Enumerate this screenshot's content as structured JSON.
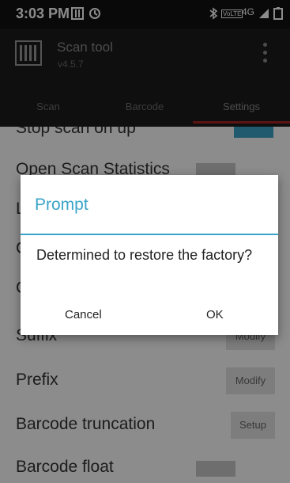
{
  "status_bar": {
    "time": "3:03 PM",
    "network_label": "4G",
    "volte_label": "VoLTE",
    "icons": [
      "gallery-icon",
      "sync-icon",
      "bluetooth-icon",
      "signal-icon",
      "battery-icon"
    ]
  },
  "app_bar": {
    "title": "Scan tool",
    "version": "v4.5.7",
    "menu_icon": "more-vert-icon"
  },
  "tabs": [
    {
      "label": "Scan",
      "active": false
    },
    {
      "label": "Barcode",
      "active": false
    },
    {
      "label": "Settings",
      "active": true
    }
  ],
  "settings": {
    "items": [
      {
        "label": "Stop scan on up",
        "control": "toggle"
      },
      {
        "label": "Open Scan Statistics",
        "control": "toggle"
      },
      {
        "label": "L",
        "control": "none"
      },
      {
        "label": "C",
        "control": "none"
      },
      {
        "label": "C",
        "control": "none"
      },
      {
        "label": "Suffix",
        "control": "button",
        "button_label": "Modify"
      },
      {
        "label": "Prefix",
        "control": "button",
        "button_label": "Modify"
      },
      {
        "label": "Barcode truncation",
        "control": "button",
        "button_label": "Setup"
      },
      {
        "label": "Barcode float",
        "control": "toggle"
      }
    ]
  },
  "dialog": {
    "title": "Prompt",
    "message": "Determined to restore the factory?",
    "cancel_label": "Cancel",
    "ok_label": "OK"
  },
  "colors": {
    "accent": "#3aa4c8",
    "tab_indicator": "#a82323",
    "status_bar": "#111111",
    "app_bar": "#1d1d1d"
  }
}
